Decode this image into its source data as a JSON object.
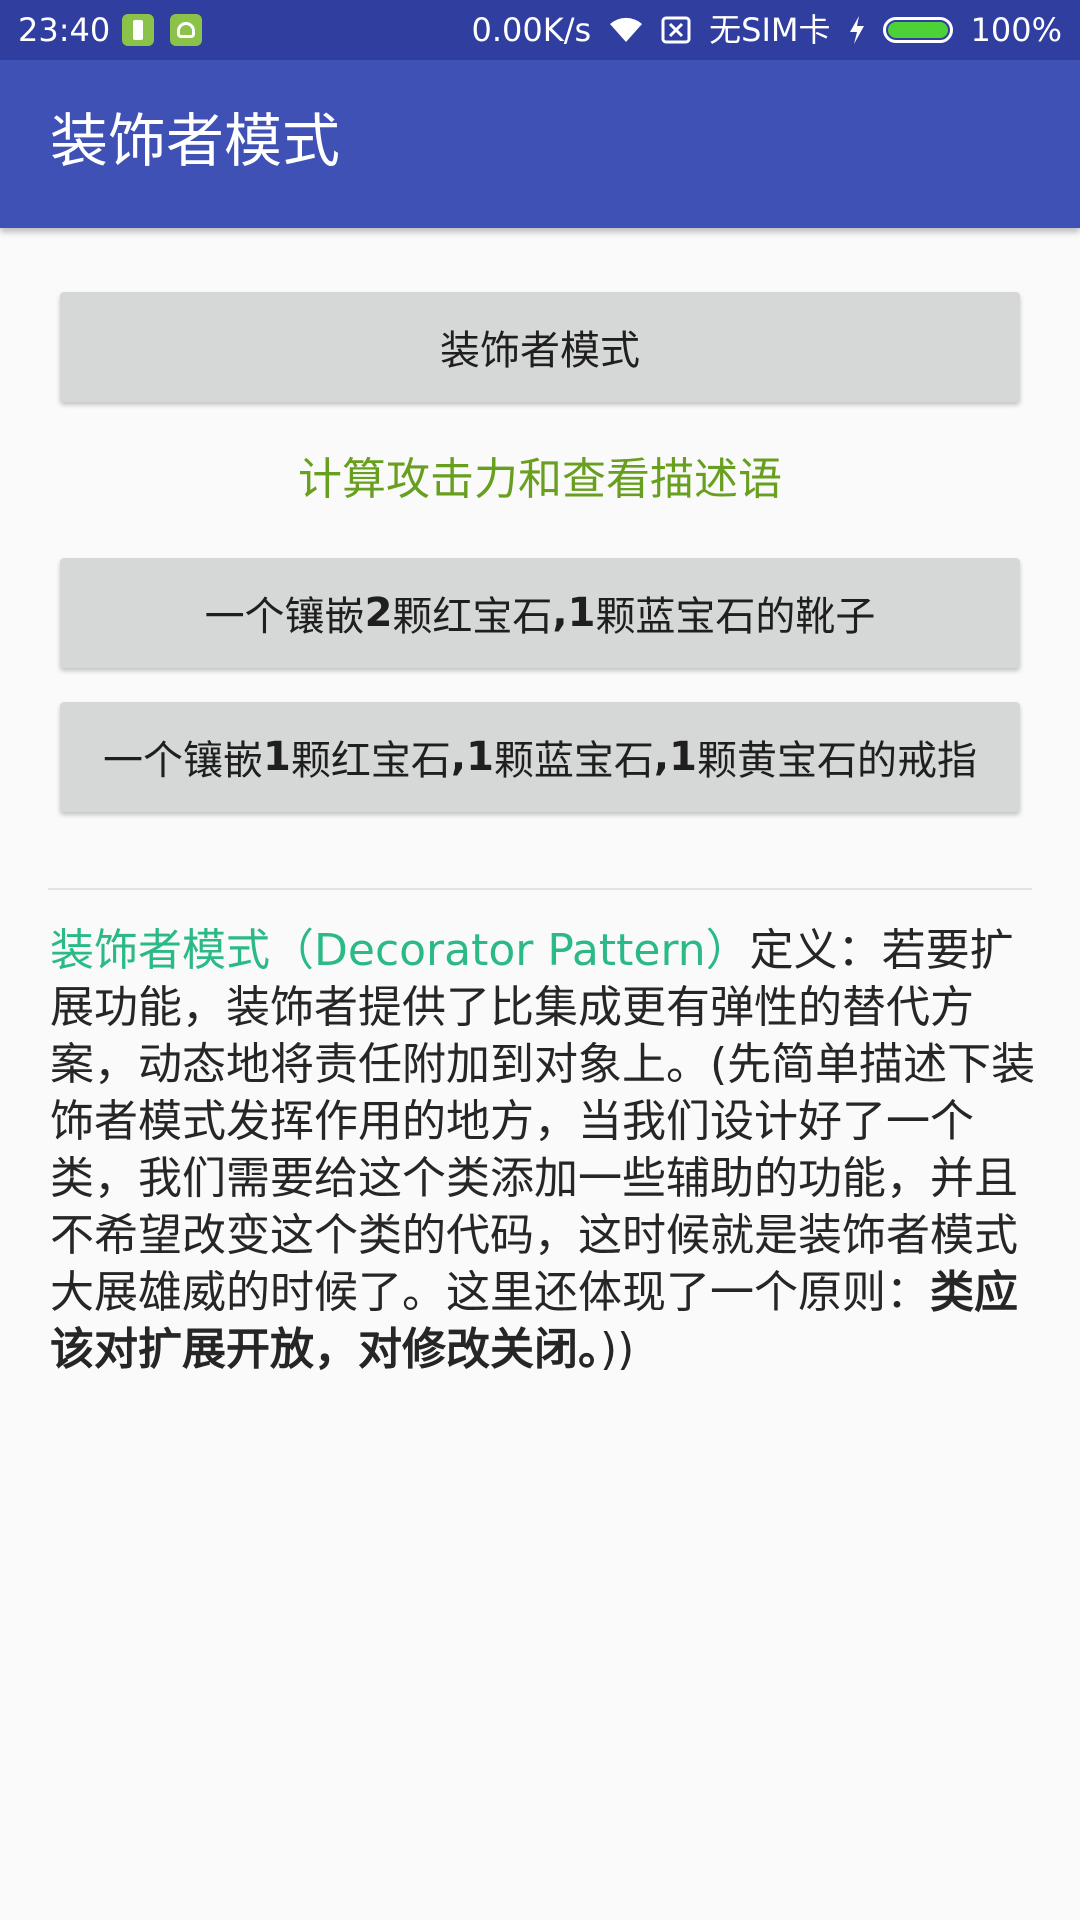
{
  "status_bar": {
    "time": "23:40",
    "network_speed": "0.00K/s",
    "sim_status": "无SIM卡",
    "battery_percent": "100%",
    "battery_level": 1.0,
    "icons": [
      "battery-notification-icon",
      "android-notification-icon",
      "wifi-icon",
      "no-sim-icon",
      "charging-bolt-icon",
      "battery-icon"
    ]
  },
  "app_bar": {
    "title": "装饰者模式"
  },
  "buttons": {
    "decorator": "装饰者模式",
    "boot_prefix": "一个镶嵌",
    "boot_num1": "2",
    "boot_mid1": "颗红宝石",
    "boot_comma_num": ",1",
    "boot_suffix": "颗蓝宝石的靴子",
    "ring_prefix": "一个镶嵌",
    "ring_num1": "1",
    "ring_mid1": "颗红宝石",
    "ring_comma_num1": ",1",
    "ring_mid2": "颗蓝宝石",
    "ring_comma_num2": ",1",
    "ring_suffix": "颗黄宝石的戒指"
  },
  "subtitle": "计算攻击力和查看描述语",
  "description": {
    "accent": "装饰者模式（Decorator Pattern）",
    "body": "定义：若要扩展功能，装饰者提供了比集成更有弹性的替代方案，动态地将责任附加到对象上。(先简单描述下装饰者模式发挥作用的地方，当我们设计好了一个类，我们需要给这个类添加一些辅助的功能，并且不希望改变这个类的代码，这时候就是装饰者模式大展雄威的时候了。这里还体现了一个原则：",
    "emphasis": "类应该对扩展开放，对修改关闭。",
    "closing": "))"
  },
  "colors": {
    "status_bar": "#303f9f",
    "app_bar": "#3f51b5",
    "subtitle": "#689f1f",
    "accent": "#2bba86",
    "button": "#d6d7d7"
  }
}
